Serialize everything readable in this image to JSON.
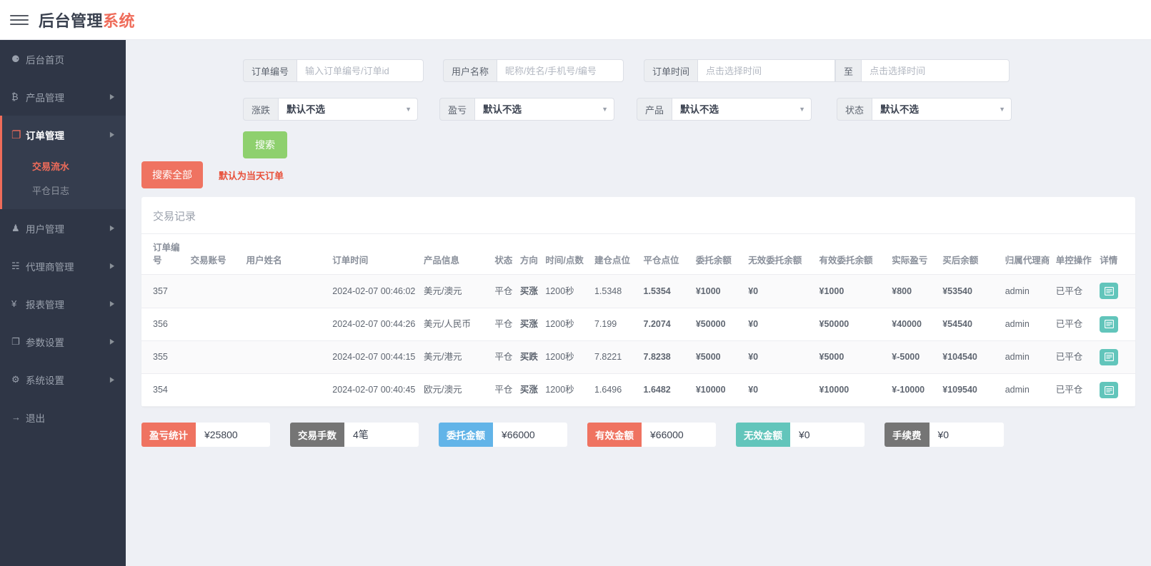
{
  "header": {
    "menu_icon": "hamburger-icon",
    "brand_part1": "后台管理",
    "brand_part2": "系统"
  },
  "sidebar": {
    "items": [
      {
        "label": "后台首页",
        "icon": "dashboard-icon",
        "glyph": "⚈",
        "has_caret": false
      },
      {
        "label": "产品管理",
        "icon": "bitcoin-icon",
        "glyph": "₿",
        "has_caret": true
      },
      {
        "label": "订单管理",
        "icon": "orders-icon",
        "glyph": "❐",
        "has_caret": true,
        "active": true
      },
      {
        "label": "用户管理",
        "icon": "user-icon",
        "glyph": "♟",
        "has_caret": true
      },
      {
        "label": "代理商管理",
        "icon": "agent-icon",
        "glyph": "☵",
        "has_caret": true
      },
      {
        "label": "报表管理",
        "icon": "yen-icon",
        "glyph": "¥",
        "has_caret": true
      },
      {
        "label": "参数设置",
        "icon": "copy-icon",
        "glyph": "❐",
        "has_caret": true
      },
      {
        "label": "系统设置",
        "icon": "gear-icon",
        "glyph": "⚙",
        "has_caret": true
      },
      {
        "label": "退出",
        "icon": "logout-icon",
        "glyph": "→",
        "has_caret": false
      }
    ],
    "submenu": [
      {
        "label": "交易流水",
        "active": true
      },
      {
        "label": "平仓日志",
        "active": false
      }
    ]
  },
  "filters": {
    "order_no": {
      "label": "订单编号",
      "placeholder": "输入订单编号/订单id",
      "value": ""
    },
    "user_name": {
      "label": "用户名称",
      "placeholder": "昵称/姓名/手机号/编号",
      "value": ""
    },
    "order_time": {
      "label": "订单时间",
      "placeholder": "点击选择时间",
      "value": "",
      "separator": "至",
      "placeholder_end": "点击选择时间",
      "value_end": ""
    },
    "rise_fall": {
      "label": "涨跌",
      "selected": "默认不选",
      "options": [
        "默认不选"
      ]
    },
    "profit_loss": {
      "label": "盈亏",
      "selected": "默认不选",
      "options": [
        "默认不选"
      ]
    },
    "product": {
      "label": "产品",
      "selected": "默认不选",
      "options": [
        "默认不选"
      ]
    },
    "status": {
      "label": "状态",
      "selected": "默认不选",
      "options": [
        "默认不选"
      ]
    },
    "search_button": "搜索",
    "search_all_button": "搜索全部",
    "hint": "默认为当天订单"
  },
  "table": {
    "title": "交易记录",
    "columns": [
      "订单编号",
      "交易账号",
      "用户姓名",
      "订单时间",
      "产品信息",
      "状态",
      "方向",
      "时间/点数",
      "建仓点位",
      "平仓点位",
      "委托余额",
      "无效委托余额",
      "有效委托余额",
      "实际盈亏",
      "买后余额",
      "归属代理商",
      "单控操作",
      "详情"
    ],
    "rows": [
      {
        "order_no": "357",
        "account": "",
        "user_name": "",
        "order_time": "2024-02-07 00:46:02",
        "product": "美元/澳元",
        "status": "平仓",
        "direction": "买涨",
        "direction_color": "red",
        "duration": "1200秒",
        "open_price": "1.5348",
        "close_price": "1.5354",
        "close_color": "red",
        "entrust_balance": "¥1000",
        "invalid_entrust": "¥0",
        "valid_entrust": "¥1000",
        "actual_pl": "¥800",
        "pl_color": "red",
        "balance_after": "¥53540",
        "agent": "admin",
        "single_control": "已平仓",
        "detail_icon": "detail-list-icon"
      },
      {
        "order_no": "356",
        "account": "",
        "user_name": "",
        "order_time": "2024-02-07 00:44:26",
        "product": "美元/人民币",
        "status": "平仓",
        "direction": "买涨",
        "direction_color": "red",
        "duration": "1200秒",
        "open_price": "7.199",
        "close_price": "7.2074",
        "close_color": "red",
        "entrust_balance": "¥50000",
        "invalid_entrust": "¥0",
        "valid_entrust": "¥50000",
        "actual_pl": "¥40000",
        "pl_color": "red",
        "balance_after": "¥54540",
        "agent": "admin",
        "single_control": "已平仓",
        "detail_icon": "detail-list-icon"
      },
      {
        "order_no": "355",
        "account": "",
        "user_name": "",
        "order_time": "2024-02-07 00:44:15",
        "product": "美元/港元",
        "status": "平仓",
        "direction": "买跌",
        "direction_color": "green",
        "duration": "1200秒",
        "open_price": "7.8221",
        "close_price": "7.8238",
        "close_color": "red",
        "entrust_balance": "¥5000",
        "invalid_entrust": "¥0",
        "valid_entrust": "¥5000",
        "actual_pl": "¥-5000",
        "pl_color": "green",
        "balance_after": "¥104540",
        "agent": "admin",
        "single_control": "已平仓",
        "detail_icon": "detail-list-icon"
      },
      {
        "order_no": "354",
        "account": "",
        "user_name": "",
        "order_time": "2024-02-07 00:40:45",
        "product": "欧元/澳元",
        "status": "平仓",
        "direction": "买涨",
        "direction_color": "red",
        "duration": "1200秒",
        "open_price": "1.6496",
        "close_price": "1.6482",
        "close_color": "green",
        "entrust_balance": "¥10000",
        "invalid_entrust": "¥0",
        "valid_entrust": "¥10000",
        "actual_pl": "¥-10000",
        "pl_color": "green",
        "balance_after": "¥109540",
        "agent": "admin",
        "single_control": "已平仓",
        "detail_icon": "detail-list-icon"
      }
    ]
  },
  "summary": [
    {
      "label": "盈亏统计",
      "value": "¥25800",
      "color": "#ef7361"
    },
    {
      "label": "交易手数",
      "value": "4笔",
      "color": "#757575"
    },
    {
      "label": "委托金额",
      "value": "¥66000",
      "color": "#62b4e8"
    },
    {
      "label": "有效金额",
      "value": "¥66000",
      "color": "#ef7361"
    },
    {
      "label": "无效金额",
      "value": "¥0",
      "color": "#62c5bb"
    },
    {
      "label": "手续费",
      "value": "¥0",
      "color": "#757575"
    }
  ],
  "colors": {
    "brand_accent": "#ef6c5a",
    "sidebar_bg": "#2f3646",
    "page_bg": "#eef0f5",
    "up_red": "#e8503a",
    "down_green": "#3fa64a",
    "search_green": "#8ed06e",
    "detail_teal": "#62c5bb"
  }
}
